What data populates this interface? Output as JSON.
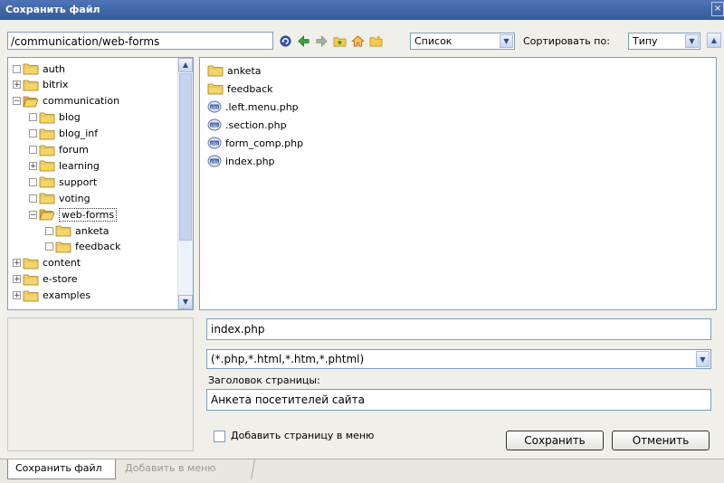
{
  "window": {
    "title": "Сохранить файл",
    "close_glyph": "×"
  },
  "toolbar": {
    "path": "/communication/web-forms",
    "icons": [
      "refresh-icon",
      "back-arrow-icon",
      "forward-arrow-icon",
      "folder-up-icon",
      "home-icon",
      "new-folder-icon"
    ],
    "view_select": "Список",
    "sort_label": "Сортировать по:",
    "sort_select": "Типу",
    "dropdown_glyph": "▼",
    "sort_dir_glyph": "▲"
  },
  "tree": {
    "expander_plus": "+",
    "expander_minus": "−",
    "scroll_up": "▲",
    "scroll_down": "▼",
    "items": [
      {
        "label": "auth",
        "level": 0,
        "expander": "none",
        "open": false
      },
      {
        "label": "bitrix",
        "level": 0,
        "expander": "plus",
        "open": false
      },
      {
        "label": "communication",
        "level": 0,
        "expander": "minus",
        "open": true
      },
      {
        "label": "blog",
        "level": 1,
        "expander": "none",
        "open": false
      },
      {
        "label": "blog_inf",
        "level": 1,
        "expander": "none",
        "open": false
      },
      {
        "label": "forum",
        "level": 1,
        "expander": "none",
        "open": false
      },
      {
        "label": "learning",
        "level": 1,
        "expander": "plus",
        "open": false
      },
      {
        "label": "support",
        "level": 1,
        "expander": "none",
        "open": false
      },
      {
        "label": "voting",
        "level": 1,
        "expander": "none",
        "open": false
      },
      {
        "label": "web-forms",
        "level": 1,
        "expander": "minus",
        "open": true,
        "selected": true
      },
      {
        "label": "anketa",
        "level": 2,
        "expander": "none",
        "open": false
      },
      {
        "label": "feedback",
        "level": 2,
        "expander": "none",
        "open": false
      },
      {
        "label": "content",
        "level": 0,
        "expander": "plus",
        "open": false
      },
      {
        "label": "e-store",
        "level": 0,
        "expander": "plus",
        "open": false
      },
      {
        "label": "examples",
        "level": 0,
        "expander": "plus",
        "open": false
      }
    ]
  },
  "files": {
    "items": [
      {
        "name": "anketa",
        "icon": "folder-icon"
      },
      {
        "name": "feedback",
        "icon": "folder-icon"
      },
      {
        "name": ".left.menu.php",
        "icon": "php-file-icon"
      },
      {
        "name": ".section.php",
        "icon": "php-file-icon"
      },
      {
        "name": "form_comp.php",
        "icon": "php-file-icon"
      },
      {
        "name": "index.php",
        "icon": "php-file-icon"
      }
    ]
  },
  "form": {
    "filename": "index.php",
    "filter": "(*.php,*.html,*.htm,*.phtml)",
    "page_title_label": "Заголовок страницы:",
    "page_title_value": "Анкета посетителей сайта",
    "add_to_menu_label": "Добавить страницу в меню",
    "add_to_menu_checked": false,
    "save_button": "Сохранить",
    "cancel_button": "Отменить"
  },
  "tabs": [
    {
      "label": "Сохранить файл",
      "active": true
    },
    {
      "label": "Добавить в меню",
      "active": false
    }
  ],
  "colors": {
    "titlebar": "#3d62a6",
    "folder": "#f2c94c",
    "selection": "#316ac5",
    "panel_border": "#7f9db9"
  }
}
